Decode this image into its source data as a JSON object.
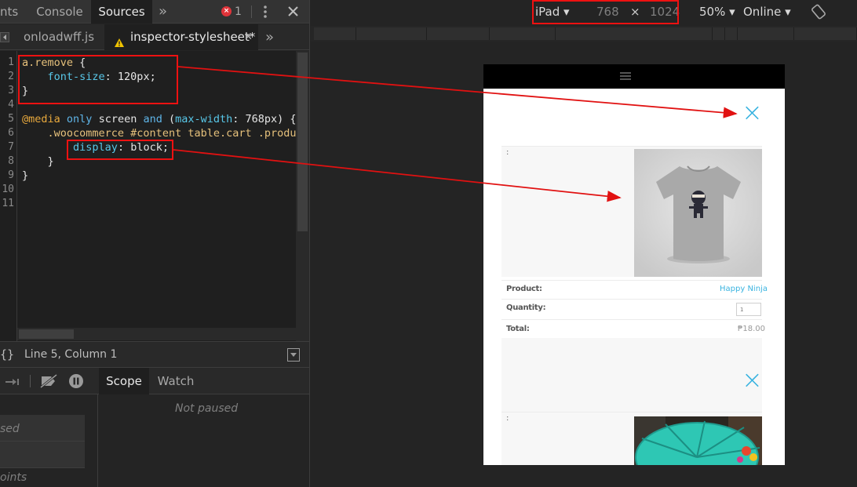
{
  "devtools": {
    "tabs": {
      "elements_partial": "nts",
      "console": "Console",
      "sources": "Sources",
      "more": "»",
      "error_count": "1"
    },
    "file_tabs": {
      "file1": "onloadwff.js",
      "file2": "inspector-stylesheet*",
      "more": "»"
    },
    "code_lines": [
      {
        "num": "1",
        "parts": [
          [
            "c-sel",
            "a.remove"
          ],
          [
            "c-val",
            " {"
          ]
        ]
      },
      {
        "num": "2",
        "parts": [
          [
            "c-val",
            "    "
          ],
          [
            "c-prop",
            "font-size"
          ],
          [
            "c-val",
            ": 120px;"
          ]
        ]
      },
      {
        "num": "3",
        "parts": [
          [
            "c-val",
            "}"
          ]
        ]
      },
      {
        "num": "4",
        "parts": []
      },
      {
        "num": "5",
        "parts": [
          [
            "c-at",
            "@media"
          ],
          [
            "c-val",
            " "
          ],
          [
            "c-kw",
            "only"
          ],
          [
            "c-val",
            " screen "
          ],
          [
            "c-kw",
            "and"
          ],
          [
            "c-val",
            " ("
          ],
          [
            "c-prop",
            "max-width"
          ],
          [
            "c-val",
            ": 768px) {"
          ]
        ]
      },
      {
        "num": "6",
        "parts": [
          [
            "c-val",
            "    "
          ],
          [
            "c-cls",
            ".woocommerce #content table.cart .product"
          ]
        ]
      },
      {
        "num": "7",
        "parts": [
          [
            "c-val",
            "        "
          ],
          [
            "c-prop",
            "display"
          ],
          [
            "c-val",
            ": block;"
          ]
        ]
      },
      {
        "num": "8",
        "parts": [
          [
            "c-val",
            "    }"
          ]
        ]
      },
      {
        "num": "9",
        "parts": [
          [
            "c-val",
            "}"
          ]
        ]
      },
      {
        "num": "10",
        "parts": []
      },
      {
        "num": "11",
        "parts": []
      }
    ],
    "status": {
      "braces": "{}",
      "position": "Line 5, Column 1"
    },
    "debugger": {
      "scope_tab": "Scope",
      "watch_tab": "Watch",
      "not_paused": "Not paused",
      "section1": "sed",
      "section2": "oints"
    }
  },
  "device_toolbar": {
    "device": "iPad",
    "width": "768",
    "times": "×",
    "height": "1024",
    "zoom": "50%",
    "network": "Online"
  },
  "page": {
    "product_label": "Product:",
    "product_value": "Happy Ninja",
    "quantity_label": "Quantity:",
    "quantity_value": "1",
    "total_label": "Total:",
    "total_value": "₱18.00",
    "colon": ":",
    "remove_icon": "×"
  },
  "colors": {
    "accent": "#39b3e0",
    "annotation": "#e11111",
    "panel_bg": "#242424"
  }
}
